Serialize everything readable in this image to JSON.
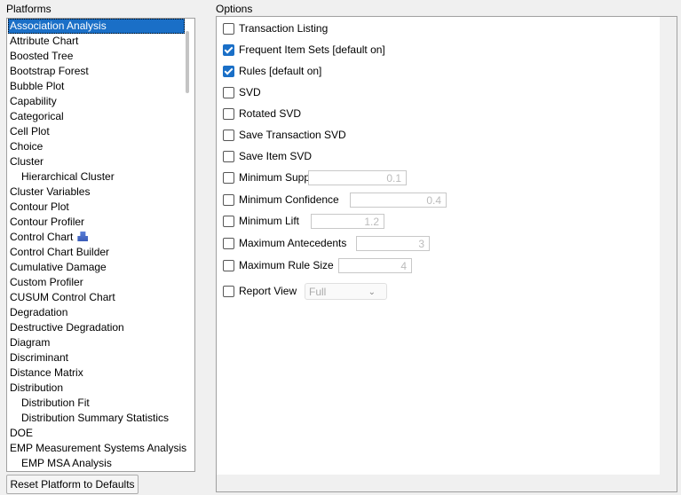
{
  "platforms": {
    "title": "Platforms",
    "items": [
      {
        "label": "Association Analysis",
        "selected": true
      },
      {
        "label": "Attribute Chart"
      },
      {
        "label": "Boosted Tree"
      },
      {
        "label": "Bootstrap Forest"
      },
      {
        "label": "Bubble Plot"
      },
      {
        "label": "Capability"
      },
      {
        "label": "Categorical"
      },
      {
        "label": "Cell Plot"
      },
      {
        "label": "Choice"
      },
      {
        "label": "Cluster"
      },
      {
        "label": "Hierarchical Cluster",
        "sub": true
      },
      {
        "label": "Cluster Variables"
      },
      {
        "label": "Contour Plot"
      },
      {
        "label": "Contour Profiler"
      },
      {
        "label": "Control Chart",
        "icon": "cubes-icon"
      },
      {
        "label": "Control Chart Builder"
      },
      {
        "label": "Cumulative Damage"
      },
      {
        "label": "Custom Profiler"
      },
      {
        "label": "CUSUM Control Chart"
      },
      {
        "label": "Degradation"
      },
      {
        "label": "Destructive Degradation"
      },
      {
        "label": "Diagram"
      },
      {
        "label": "Discriminant"
      },
      {
        "label": "Distance Matrix"
      },
      {
        "label": "Distribution"
      },
      {
        "label": "Distribution Fit",
        "sub": true
      },
      {
        "label": "Distribution Summary Statistics",
        "sub": true
      },
      {
        "label": "DOE"
      },
      {
        "label": "EMP Measurement Systems Analysis"
      },
      {
        "label": "EMP MSA Analysis",
        "sub": true
      }
    ],
    "reset_label": "Reset Platform to Defaults"
  },
  "options": {
    "title": "Options",
    "items": [
      {
        "label": "Transaction Listing",
        "checked": false
      },
      {
        "label": "Frequent Item Sets [default on]",
        "checked": true
      },
      {
        "label": "Rules [default on]",
        "checked": true
      },
      {
        "label": "SVD",
        "checked": false
      },
      {
        "label": "Rotated SVD",
        "checked": false
      },
      {
        "label": "Save Transaction SVD",
        "checked": false
      },
      {
        "label": "Save Item SVD",
        "checked": false
      },
      {
        "label": "Minimum Support",
        "checked": false,
        "value": "0.1"
      },
      {
        "label": "Minimum Confidence",
        "checked": false,
        "value": "0.4"
      },
      {
        "label": "Minimum Lift",
        "checked": false,
        "value": "1.2"
      },
      {
        "label": "Maximum Antecedents",
        "checked": false,
        "value": "3"
      },
      {
        "label": "Maximum Rule Size",
        "checked": false,
        "value": "4"
      },
      {
        "label": "Report View",
        "checked": false,
        "select": "Full"
      }
    ]
  },
  "colors": {
    "selection": "#1a6fc7"
  }
}
